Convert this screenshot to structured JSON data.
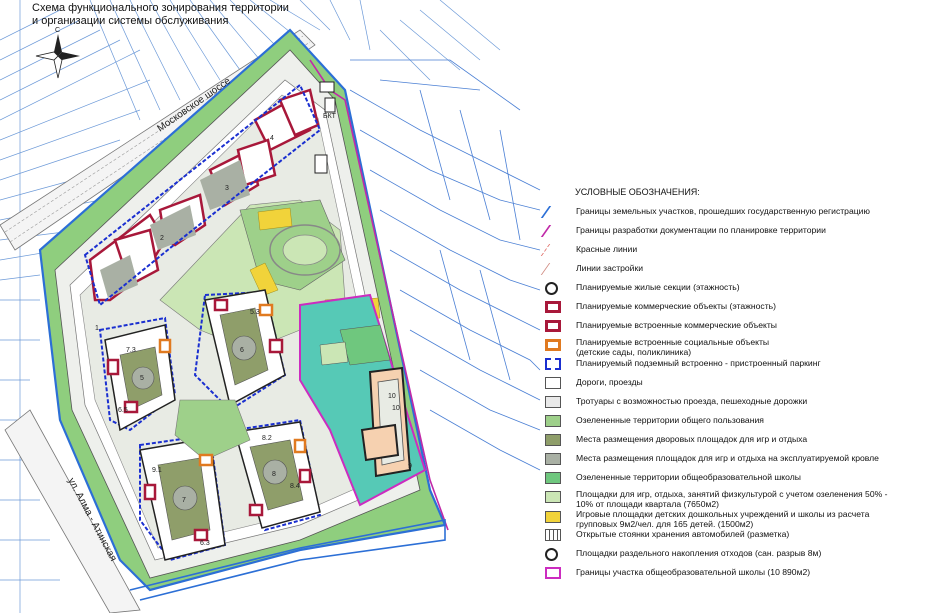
{
  "title": {
    "line1": "Схема функционального зонирования территории",
    "line2": "и организации системы обслуживания"
  },
  "north_arrow": {
    "icon": "north-arrow-icon",
    "label": "С"
  },
  "map": {
    "road_labels": {
      "moscow_highway": "Московское шоссе",
      "alma_ata": "ул. Алма - Атинская",
      "bkt": "БКТ"
    },
    "section_numbers": [
      "1",
      "2",
      "3",
      "4",
      "5",
      "6",
      "7",
      "8",
      "9",
      "10"
    ],
    "floor_badges": [
      "7.3",
      "6.5",
      "5.3",
      "9.1",
      "8.4",
      "8.2",
      "6.3",
      "10"
    ]
  },
  "legend": {
    "title": "УСЛОВНЫЕ ОБОЗНАЧЕНИЯ:",
    "items": [
      {
        "label": "Границы  земельных участков, прошедших государственную регистрацию",
        "symbol": "land-plot-boundary-line",
        "color": "#2c6fd6"
      },
      {
        "label": "Границы  разработки документации по планировке территории",
        "symbol": "planning-boundary-line",
        "color": "#c02aa8"
      },
      {
        "label": "Красные линии",
        "symbol": "red-line",
        "color": "#e0706a"
      },
      {
        "label": "Линии застройки",
        "symbol": "building-line",
        "color": "#d08a80"
      },
      {
        "label": "Планируемые жилые секции (этажность)",
        "symbol": "residential-section",
        "color": "#222222"
      },
      {
        "label": "Планируемые  коммерческие объекты  (этажность)",
        "symbol": "commercial-object",
        "color": "#a8183a"
      },
      {
        "label": "Планируемые встроенные  коммерческие объекты",
        "symbol": "embedded-commercial",
        "color": "#a8183a"
      },
      {
        "label": "Планируемые встроенные  социальные объекты\n(детские сады, поликлиника)",
        "symbol": "embedded-social",
        "color": "#e07a20"
      },
      {
        "label": "Планируемый подземный встроенно - пристроенный паркинг",
        "symbol": "underground-parking",
        "color": "#1a2fd0"
      },
      {
        "label": "Дороги, проезды",
        "symbol": "roads",
        "color": "#ffffff"
      },
      {
        "label": "Тротуары с возможностью проезда, пешеходные дорожки",
        "symbol": "sidewalks",
        "color": "#e9e9e9"
      },
      {
        "label": "Озелененные территории общего пользования",
        "symbol": "public-green",
        "color": "#9ed08a"
      },
      {
        "label": "Места размещения дворовых площадок для игр и отдыха",
        "symbol": "courtyard-playgrounds",
        "color": "#8f9e6a"
      },
      {
        "label": "Места размещения площадок для игр и отдыха на эксплуатируемой кровле",
        "symbol": "roof-playgrounds",
        "color": "#a9b0a4"
      },
      {
        "label": "Озелененные территории общеобразовательной школы",
        "symbol": "school-green",
        "color": "#6fc77e"
      },
      {
        "label": "Площадки для игр, отдыха, занятий физкультурой    с учетом озеленения 50% -\n10% от площади квартала (7650м2)",
        "symbol": "sport-areas",
        "color": "#cbe6b5"
      },
      {
        "label": "Игровые площадки детских дошкольных учреждений и школы из расчета\nгрупповых 9м2/чел. для 165 детей. (1500м2)",
        "symbol": "kindergarten-playgrounds",
        "color": "#f1d33a"
      },
      {
        "label": "Открытые стоянки хранения автомобилей (разметка)",
        "symbol": "open-parking",
        "color": "#ffffff"
      },
      {
        "label": "Площадки раздельного накопления  отходов (сан. разрыв 8м)",
        "symbol": "waste-collection",
        "color": "#222222"
      },
      {
        "label": "Границы участка общеобразовательной школы (10 890м2)",
        "symbol": "school-plot-boundary",
        "color": "#cc2cc0"
      }
    ]
  },
  "colors": {
    "green": "#8fce7e",
    "light_green": "#cbe6b5",
    "olive": "#8f9e6a",
    "grey": "#a9b0a4",
    "yellow": "#f1d33a",
    "teal": "#56c9b6",
    "blue": "#2c6fd6",
    "magenta": "#c02aa8",
    "dark_red": "#a8183a",
    "orange": "#e07a20",
    "navy": "#1a2fd0"
  }
}
